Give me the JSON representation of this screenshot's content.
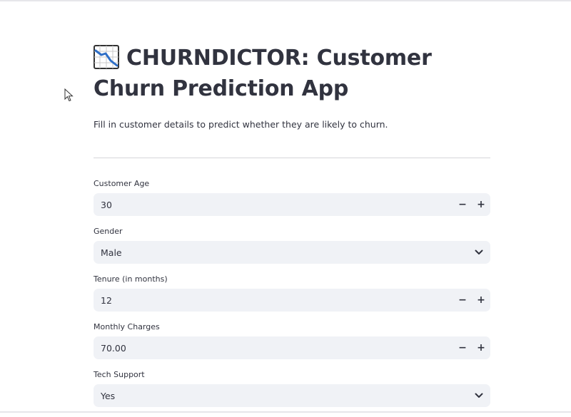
{
  "app": {
    "title": "CHURNDICTOR: Customer Churn Prediction App",
    "title_icon": "chart-decreasing-icon",
    "subtitle": "Fill in customer details to predict whether they are likely to churn."
  },
  "form": {
    "customer_age": {
      "label": "Customer Age",
      "value": "30",
      "minus": "−",
      "plus": "+"
    },
    "gender": {
      "label": "Gender",
      "value": "Male",
      "icon": "chevron-down-icon"
    },
    "tenure": {
      "label": "Tenure (in months)",
      "value": "12",
      "minus": "−",
      "plus": "+"
    },
    "monthly_charges": {
      "label": "Monthly Charges",
      "value": "70.00",
      "minus": "−",
      "plus": "+"
    },
    "tech_support": {
      "label": "Tech Support",
      "value": "Yes",
      "icon": "chevron-down-icon"
    }
  },
  "colors": {
    "input_bg": "#f0f2f6",
    "text": "#31333f",
    "divider": "#d6d6d9"
  }
}
